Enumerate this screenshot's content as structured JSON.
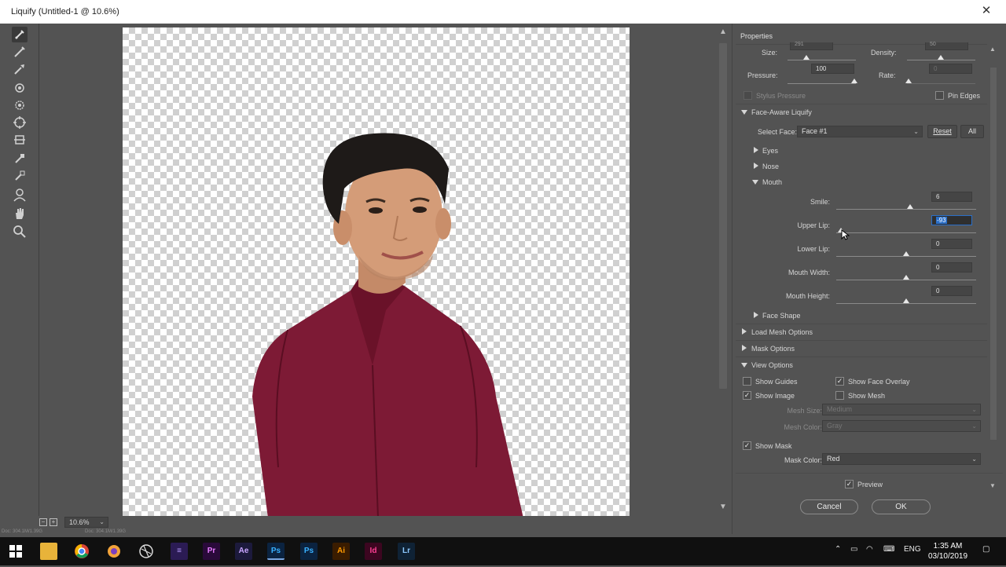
{
  "window": {
    "title": "Liquify (Untitled-1 @ 10.6%)"
  },
  "statusbar": {
    "zoom": "10.6%",
    "info_left": "Doc: 304.1M/1.39G",
    "info_mid": "Doc: 304.1M/1.39G"
  },
  "panel": {
    "title": "Properties",
    "brush": {
      "size_label": "Size:",
      "size_value": "291",
      "density_label": "Density:",
      "density_value": "50",
      "pressure_label": "Pressure:",
      "pressure_value": "100",
      "rate_label": "Rate:",
      "rate_value": "0",
      "stylus_label": "Stylus Pressure",
      "pin_label": "Pin Edges"
    },
    "face_aware": {
      "title": "Face-Aware Liquify",
      "select_face_label": "Select Face:",
      "select_face_value": "Face #1",
      "reset_label": "Reset",
      "all_label": "All",
      "eyes_label": "Eyes",
      "nose_label": "Nose",
      "mouth_label": "Mouth",
      "mouth": {
        "smile_label": "Smile:",
        "smile_value": "6",
        "smile_level": 6,
        "upper_lip_label": "Upper Lip:",
        "upper_lip_value": "-93",
        "upper_lip_level": -93,
        "lower_lip_label": "Lower Lip:",
        "lower_lip_value": "0",
        "lower_lip_level": 0,
        "mouth_width_label": "Mouth Width:",
        "mouth_width_value": "0",
        "mouth_width_level": 0,
        "mouth_height_label": "Mouth Height:",
        "mouth_height_value": "0",
        "mouth_height_level": 0
      },
      "face_shape_label": "Face Shape"
    },
    "load_mesh_label": "Load Mesh Options",
    "mask_options_label": "Mask Options",
    "view_options": {
      "title": "View Options",
      "show_guides": "Show Guides",
      "show_face_overlay": "Show Face Overlay",
      "show_image": "Show Image",
      "show_mesh": "Show Mesh",
      "mesh_size_label": "Mesh Size:",
      "mesh_size_value": "Medium",
      "mesh_color_label": "Mesh Color:",
      "mesh_color_value": "Gray",
      "show_mask": "Show Mask",
      "mask_color_label": "Mask Color:",
      "mask_color_value": "Red"
    },
    "preview_label": "Preview",
    "cancel_label": "Cancel",
    "ok_label": "OK"
  },
  "taskbar": {
    "language": "ENG",
    "time": "1:35 AM",
    "date": "03/10/2019",
    "apps": [
      "Pr",
      "Ae",
      "Ps",
      "Ps",
      "Ai",
      "Id",
      "Lr"
    ]
  },
  "colors": {
    "shirt": "#7d1a35",
    "accent": "#2a6fc9",
    "panel": "#535353"
  }
}
